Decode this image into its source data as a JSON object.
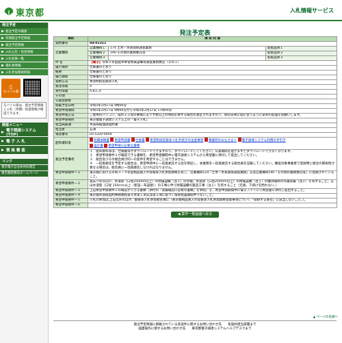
{
  "header": {
    "logo_text": "東京都",
    "service_title": "入札情報サービス"
  },
  "sidebar": {
    "menu_head": "発注予定",
    "items": [
      "発注予定の検索",
      "年間発注予定情報",
      "発注予定情報",
      "入札公告・指名情報",
      "入札結果一覧",
      "落札者情報",
      "入札参加資格情報"
    ],
    "mobile_button": "モバイル版",
    "mobile_note": "モバイル版は、発注予定情報と入札（見積）経過情報が確認できます。",
    "related_head": "関連メニュー",
    "big_items": [
      "電子調達システム(TOP)",
      "電 子 入 札",
      "資 格 審 査"
    ],
    "links_head": "リンク",
    "links": [
      "東京電子自治体共同運営",
      "東京都財務局ホームページ"
    ]
  },
  "main": {
    "page_title": "発注予定表",
    "col_item": "項目",
    "col_content": "項 目 内 容",
    "rows": {
      "contract_no_label": "契約番号",
      "contract_no": "04-01311",
      "industry_label": "営業種目",
      "industry_1_sub": "営業種目１",
      "industry_1": "174 土木・水系関係調査業務",
      "industry_2_sub": "営業種目２",
      "industry_2": "190 その他の業務委託等",
      "industry_3_sub": "営業種目３",
      "industry_3": "",
      "industry_note_1": "取扱品目１",
      "industry_note_2": "取扱品目２",
      "industry_note_3": "取扱品目３",
      "subject_label": "件 名",
      "subject_badge": "【電子】",
      "subject": "令和５年度配水本管附属設備等調査業務委託（その１）",
      "location_label": "履行場所",
      "location": "仕様書のとおり",
      "summary_label": "概要",
      "summary": "仕様書のとおり",
      "period_label": "履行期間",
      "period": "仕様書のとおり",
      "method_label": "契約方法",
      "method": "希望制指名競争入札",
      "grade_label": "発注等級",
      "grade": "A",
      "eligible_label": "受付等級",
      "eligible": "A,B,C,X",
      "other_label": "その他",
      "other": "",
      "announce_label": "公開登録者",
      "announce": "",
      "open_label": "閲覧予定日時",
      "open": "令和5年2月17日 9時00分",
      "apply_label": "希望申請期間",
      "apply": "令和5年2月17日 9時00分から令和5年2月27日 17時00分",
      "apply_method_label": "希望申請方法",
      "apply_method": "ご使用のパソコン、操作ミス等の事情により予想以上の時間を要する場合も想定されますので、締切日時に間に合うように早めの処理をお願いします。",
      "system_label": "希望申請場所",
      "system": "東京都電子調達システム上の「電子入札」",
      "dept_label": "担当局部課",
      "dept": "水道局経理部契約課",
      "person_label": "担当者",
      "person": "石澤",
      "tel_label": "電話番号",
      "tel": "03-5320-6404",
      "files_label": "配布資料等",
      "files": [
        "見積依頼書",
        "希望申請書",
        "仕様書",
        "希望制指名競争入札手続きの注意事項",
        "事業所のみなさまへ",
        "電子調達システム利用の手引き"
      ],
      "files_2": [
        "設計書",
        "希望申請に必要な書類"
      ],
      "cond_label": "発注予定備考",
      "cond": "１　配布資料等は、仕様書等がダウンロードできますので、ダウンロードしてください。公表期間を過ぎますとダウンロードできなくなります。\n２　希望申請要件２が確認できる書類を、希望申請期間中に電子調達システムから希望書に添付して提出してください。\n３　組合及びその組合員が同一の案件を希望することはできません。\n４　一括再委託を予定する組合は、希望申請中に一括再委託する旨を明記し、本業務を一括再委託する組合員を記載してください。審査対象事業者で登録時と組合の関係性が異なる場合は、組合員に一括再委託しなければなりません。",
      "req1_label": "希望申請要件ー１",
      "req1": "東京都における令和３・４年度物品買入れ等競争入札参加資格を有し、営業種目124「土木・水系関係調査業務」又は営業種目190「その他の業務委託等」に登録されていること。",
      "req2_label": "希望申請要件ー２",
      "req2": "過去５年以内に、水道管（口径250mm以上）の附属設備（注１）の点検、水道管（口径250mm以上）の附属設備（注１）の維持補修の作業実績（注２）を有すること。又は水道管（口径 250mm以上（新設・布設替））の工事に伴う附属設備の築造工事（注２）を有すること（元請、下請けを問わない。）",
      "req3_label": "希望申請要件ー３",
      "req3": "上記希望申請要件２の確認ができる書類（添付の「実績確認に必要な書類」を参照）を、希望申請期間中に電子ファイルで希望書に添付し提出すること。",
      "req4_label": "希望申請要件ー４",
      "req4": "東京都水道局契約事務規程第８条第１項又は第２項に基づく排除措置期間中でないこと。",
      "req5_label": "希望申請要件ー５",
      "req5": "入札の参加は,上記以外のほか、都競争入札参加者名簿に（東京都物品買入れ等競争入札参加資格登録事項について「関係する会社」に該当しないこと。）。",
      "req6_label": "希望申請要件ー６",
      "req6": ""
    },
    "back_button": "◀ 案件一覧画面へ戻る"
  },
  "footer": {
    "line1": "発注予定情報に掲載されている各案件に関するお問い合わせ先　　各契約担当部署まで",
    "line2": "画面操作に関するお問い合わせ先　　東京都電子調達システムヘルプデスクまで",
    "pagetop": "▲ ページの先頭へ"
  }
}
